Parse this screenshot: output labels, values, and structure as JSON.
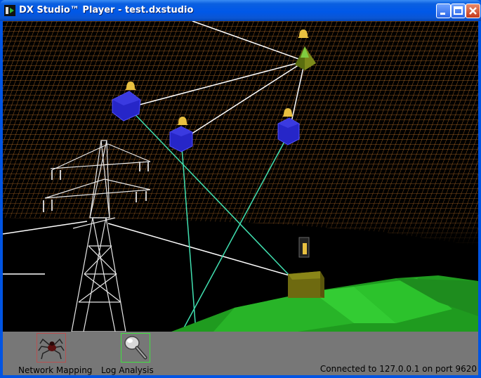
{
  "window": {
    "title": "DX Studio™ Player - test.dxstudio",
    "controls": [
      "minimize",
      "maximize",
      "close"
    ]
  },
  "scene": {
    "description_icons": [
      "node-cube-icon",
      "pyramid-node-icon",
      "pylon-icon",
      "router-box-icon",
      "alert-bell-icon"
    ]
  },
  "toolbar": {
    "tools": [
      {
        "label": "Network Mapping",
        "icon": "spider-icon"
      },
      {
        "label": "Log Analysis",
        "icon": "magnifier-icon"
      }
    ],
    "status": "Connected to 127.0.0.1 on port 9620"
  },
  "colors": {
    "titlebar": "#0054e3",
    "grid": "#c8782a",
    "link": "#ffffff",
    "link_green": "#40e0b0",
    "node_blue": "#2a2ad0",
    "ground": "#22aa22",
    "toolbar_bg": "#777777"
  }
}
